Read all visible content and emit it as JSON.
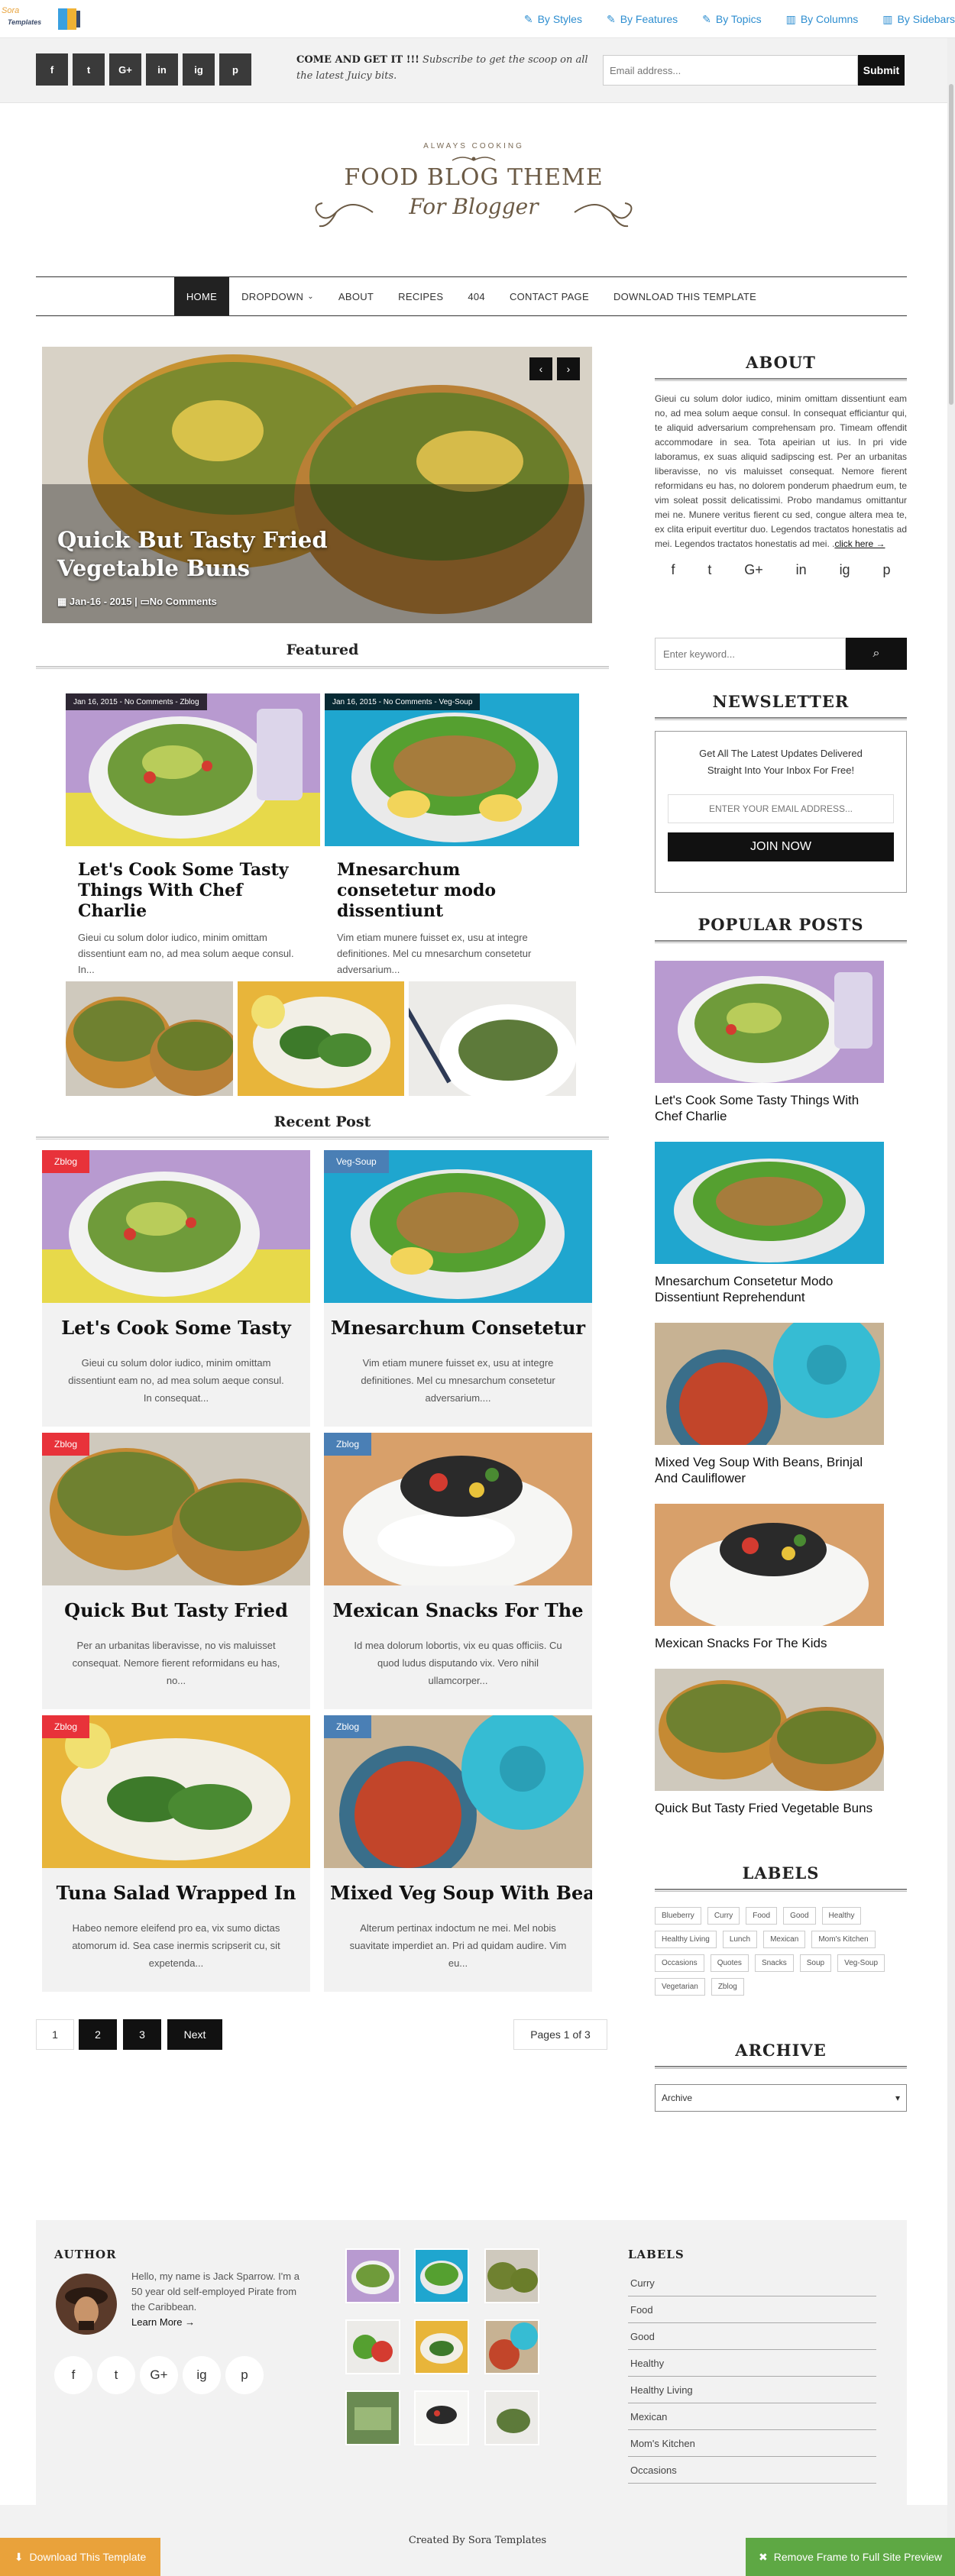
{
  "frame": {
    "logo_line1": "Sora",
    "logo_line2": "Templates",
    "links": [
      {
        "label": "By Styles",
        "icon": "pen-icon"
      },
      {
        "label": "By Features",
        "icon": "pen-icon"
      },
      {
        "label": "By Topics",
        "icon": "pen-icon"
      },
      {
        "label": "By Columns",
        "icon": "columns-icon"
      },
      {
        "label": "By Sidebars",
        "icon": "columns-icon"
      }
    ],
    "download_label": "Download This Template",
    "remove_label": "Remove Frame to Full Site Preview"
  },
  "topbar": {
    "social": [
      "f",
      "t",
      "G+",
      "in",
      "ig",
      "p"
    ],
    "subscribe_bold": "COME AND GET IT !!!",
    "subscribe_text": "Subscribe to get the scoop on all the latest Juicy bits.",
    "email_placeholder": "Email address...",
    "submit_label": "Submit"
  },
  "brand": {
    "tagline": "ALWAYS COOKING",
    "line1": "FOOD BLOG THEME",
    "line2": "For Blogger"
  },
  "nav": {
    "items": [
      "HOME",
      "DROPDOWN",
      "ABOUT",
      "RECIPES",
      "404",
      "CONTACT PAGE",
      "DOWNLOAD THIS TEMPLATE"
    ]
  },
  "slider": {
    "title": "Quick But Tasty Fried Vegetable Buns",
    "date": "Jan-16 - 2015 |",
    "comments": "No Comments",
    "prev": "‹",
    "next": "›"
  },
  "featured": {
    "heading": "Featured",
    "cards": [
      {
        "meta": "Jan 16, 2015 - No Comments - Zblog",
        "title": "Let's Cook Some Tasty Things With Chef Charlie",
        "snippet": "Gieui cu solum dolor iudico, minim omittam dissentiunt eam no, ad mea solum aeque consul. In..."
      },
      {
        "meta": "Jan 16, 2015 - No Comments - Veg-Soup",
        "title": "Mnesarchum consetetur modo dissentiunt",
        "snippet": "Vim etiam munere fuisset ex, usu at integre definitiones. Mel cu mnesarchum consetetur adversarium..."
      }
    ]
  },
  "recent": {
    "heading": "Recent Post",
    "cards": [
      {
        "badge": "Zblog",
        "badge_color": "#e8323a",
        "title": "Let's Cook Some Tasty",
        "snippet": "Gieui cu solum dolor iudico, minim omittam dissentiunt eam no, ad mea solum aeque consul. In consequat..."
      },
      {
        "badge": "Veg-Soup",
        "badge_color": "#4a7fb5",
        "title": "Mnesarchum Consetetur",
        "snippet": "Vim etiam munere fuisset ex, usu at integre definitiones. Mel cu mnesarchum consetetur adversarium...."
      },
      {
        "badge": "Zblog",
        "badge_color": "#e8323a",
        "title": "Quick But Tasty Fried",
        "snippet": "Per an urbanitas liberavisse, no vis maluisset consequat. Nemore fierent reformidans eu has, no..."
      },
      {
        "badge": "Zblog",
        "badge_color": "#4a7fb5",
        "title": "Mexican Snacks For The",
        "snippet": "Id mea dolorum lobortis, vix eu quas officiis. Cu quod ludus disputando vix. Vero nihil ullamcorper..."
      },
      {
        "badge": "Zblog",
        "badge_color": "#e8323a",
        "title": "Tuna Salad Wrapped In",
        "snippet": "Habeo nemore eleifend pro ea, vix sumo dictas atomorum id. Sea case inermis scripserit cu, sit expetenda..."
      },
      {
        "badge": "Zblog",
        "badge_color": "#4a7fb5",
        "title": "Mixed Veg Soup With Beans,",
        "snippet": "Alterum pertinax indoctum ne mei. Mel nobis suavitate imperdiet an. Pri ad quidam audire. Vim eu..."
      }
    ]
  },
  "pagination": {
    "pages": [
      "1",
      "2",
      "3"
    ],
    "next": "Next",
    "summary": "Pages 1 of 3"
  },
  "sidebar": {
    "about_heading": "ABOUT",
    "about_text": "Gieui cu solum dolor iudico, minim omittam dissentiunt eam no, ad mea solum aeque consul. In consequat efficiantur qui, te aliquid adversarium comprehensam pro. Timeam offendit accommodare in sea. Tota apeirian ut ius. In pri vide laboramus, ex suas aliquid sadipscing est. Per an urbanitas liberavisse, no vis maluisset consequat. Nemore fierent reformidans eu has, no dolorem ponderum phaedrum eum, te vim soleat possit delicatissimi. Probo mandamus omittantur mei ne. Munere veritus fierent cu sed, congue altera mea te, ex clita eripuit evertitur duo. Legendos tractatos honestatis ad mei. Legendos tractatos honestatis ad mei. .",
    "about_link": "click here →",
    "social": [
      "f",
      "t",
      "G+",
      "in",
      "ig",
      "p"
    ],
    "search_placeholder": "Enter keyword...",
    "newsletter_heading": "NEWSLETTER",
    "newsletter_text": "Get All The Latest Updates Delivered Straight Into Your Inbox For Free!",
    "newsletter_placeholder": "ENTER YOUR EMAIL ADDRESS...",
    "newsletter_button": "JOIN NOW",
    "popular_heading": "POPULAR POSTS",
    "popular": [
      "Let's Cook Some Tasty Things With Chef Charlie",
      "Mnesarchum Consetetur Modo Dissentiunt Reprehendunt",
      "Mixed Veg Soup With Beans, Brinjal And Cauliflower",
      "Mexican Snacks For The Kids",
      "Quick But Tasty Fried Vegetable Buns"
    ],
    "labels_heading": "LABELS",
    "labels": [
      "Blueberry",
      "Curry",
      "Food",
      "Good",
      "Healthy",
      "Healthy Living",
      "Lunch",
      "Mexican",
      "Mom's Kitchen",
      "Occasions",
      "Quotes",
      "Snacks",
      "Soup",
      "Veg-Soup",
      "Vegetarian",
      "Zblog"
    ],
    "archive_heading": "ARCHIVE",
    "archive_value": "Archive"
  },
  "footer": {
    "author_heading": "AUTHOR",
    "author_text": "Hello, my name is Jack Sparrow. I'm a 50 year old self-employed Pirate from the Caribbean.",
    "learn_more": "Learn More →",
    "social": [
      "f",
      "t",
      "G+",
      "ig",
      "p"
    ],
    "labels_heading": "LABELS",
    "labels": [
      "Curry",
      "Food",
      "Good",
      "Healthy",
      "Healthy Living",
      "Mexican",
      "Mom's Kitchen",
      "Occasions"
    ],
    "credit": "Created By Sora Templates"
  }
}
